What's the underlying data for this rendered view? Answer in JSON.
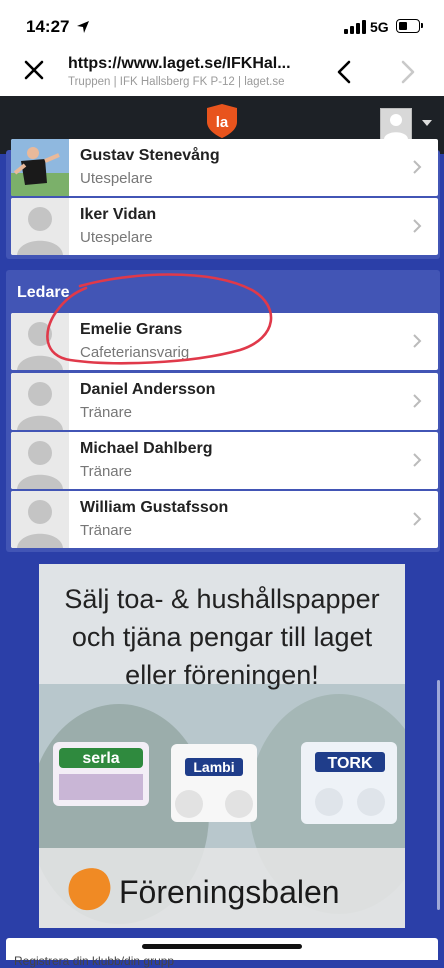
{
  "status": {
    "time": "14:27",
    "network": "5G"
  },
  "browser": {
    "url": "https://www.laget.se/IFKHal...",
    "page_title": "Truppen | IFK Hallsberg FK P-12 | laget.se"
  },
  "app": {
    "logo_text": "la"
  },
  "players_partial": [
    {
      "name": "Gustav Stenevång",
      "role": "Utespelare"
    },
    {
      "name": "Iker Vidan",
      "role": "Utespelare"
    }
  ],
  "leaders": {
    "title": "Ledare",
    "items": [
      {
        "name": "Emelie Grans",
        "role": "Cafeteriansvarig"
      },
      {
        "name": "Daniel Andersson",
        "role": "Tränare"
      },
      {
        "name": "Michael Dahlberg",
        "role": "Tränare"
      },
      {
        "name": "William Gustafsson",
        "role": "Tränare"
      }
    ]
  },
  "ad": {
    "line1": "Sälj toa- & hushållspapper",
    "line2": "och tjäna pengar till laget",
    "line3": "eller föreningen!",
    "brand": "Föreningsbalen",
    "products": [
      "serla",
      "Lambi",
      "TORK"
    ]
  },
  "bottom": {
    "text": "Registrera din klubb/din grupp"
  },
  "colors": {
    "page_bg": "#2b3fa8",
    "panel": "#4255b5",
    "header": "#1d2126",
    "logo": "#e8541d",
    "annotation": "#e0394a"
  }
}
